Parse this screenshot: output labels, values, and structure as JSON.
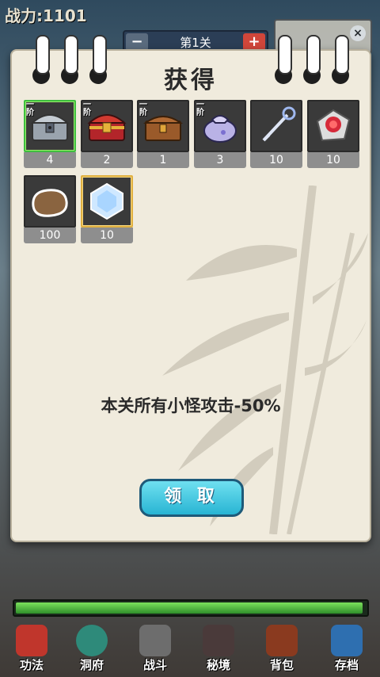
{
  "hud": {
    "power_label": "战力:1101",
    "stage_label": "第1关",
    "minus": "−",
    "plus": "+",
    "close": "×"
  },
  "dialog": {
    "title": "获得",
    "items": [
      {
        "name": "silver-chest",
        "tier": "一阶",
        "count": "4",
        "frame": "green"
      },
      {
        "name": "red-gold-chest",
        "tier": "一阶",
        "count": "2",
        "frame": "plain"
      },
      {
        "name": "wooden-chest",
        "tier": "一阶",
        "count": "1",
        "frame": "plain"
      },
      {
        "name": "purple-pouch",
        "tier": "一阶",
        "count": "3",
        "frame": "plain"
      },
      {
        "name": "crystal-key",
        "tier": "",
        "count": "10",
        "frame": "plain"
      },
      {
        "name": "rose-stone",
        "tier": "",
        "count": "10",
        "frame": "plain"
      },
      {
        "name": "clay-stone",
        "tier": "",
        "count": "100",
        "frame": "plain"
      },
      {
        "name": "ice-crystal",
        "tier": "",
        "count": "10",
        "frame": "gold"
      }
    ],
    "notice": "本关所有小怪攻击-50%",
    "claim_label": "领 取"
  },
  "progress": {
    "fraction": 0.99
  },
  "nav": {
    "items": [
      {
        "label": "功法",
        "icon": "scroll-icon",
        "color": "#c0362c"
      },
      {
        "label": "洞府",
        "icon": "swirl-icon",
        "color": "#2e8a7a"
      },
      {
        "label": "战斗",
        "icon": "sword-icon",
        "color": "#6d6d6d"
      },
      {
        "label": "秘境",
        "icon": "cave-icon",
        "color": "#4a3a3a"
      },
      {
        "label": "背包",
        "icon": "bag-icon",
        "color": "#8a3a1f"
      },
      {
        "label": "存档",
        "icon": "save-icon",
        "color": "#2e6fb0"
      }
    ]
  }
}
